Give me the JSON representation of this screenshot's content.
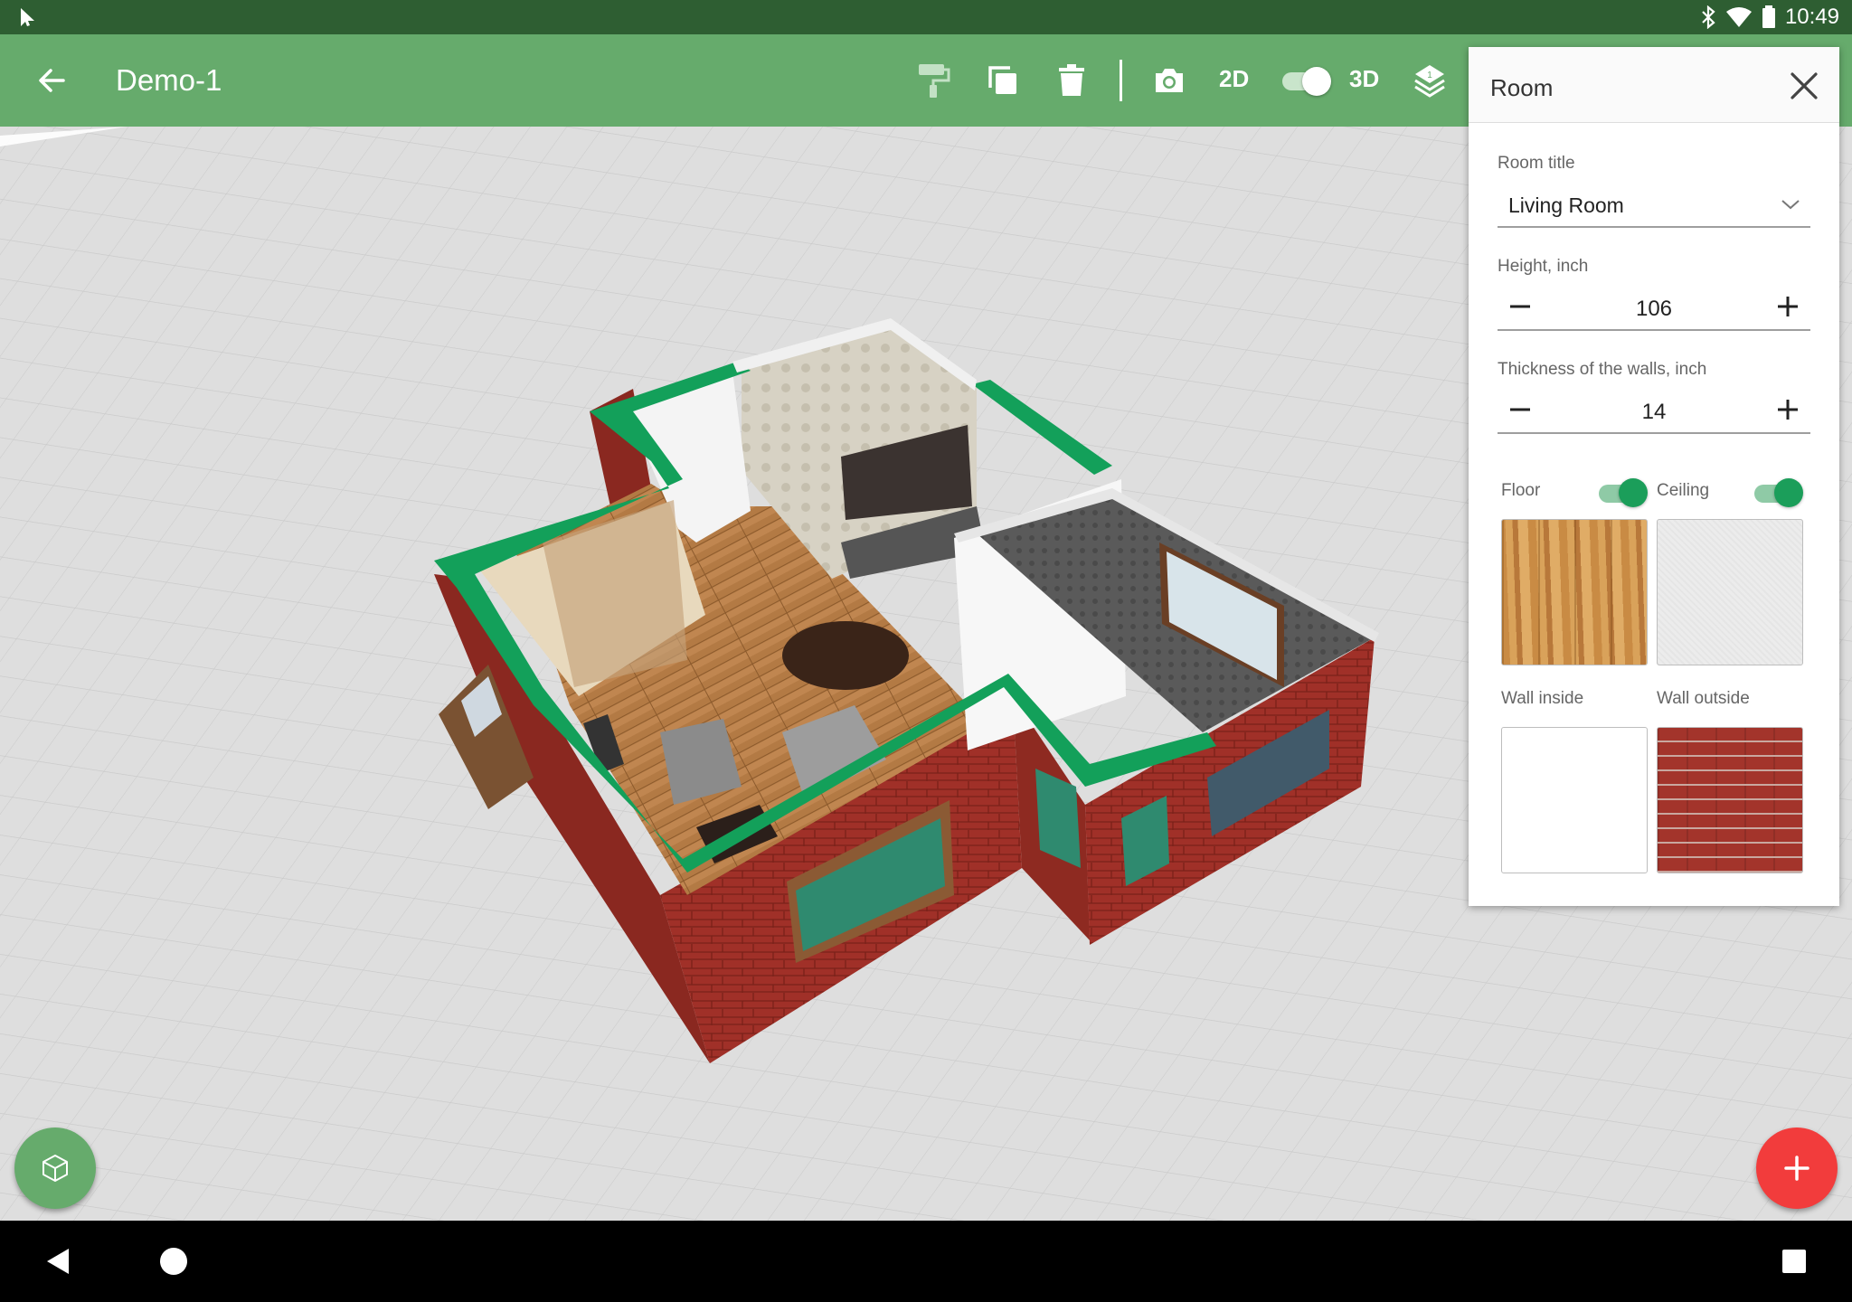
{
  "status_bar": {
    "time": "10:49"
  },
  "app_bar": {
    "title": "Demo-1",
    "view_2d_label": "2D",
    "view_3d_label": "3D"
  },
  "room_panel": {
    "title": "Room",
    "room_title_label": "Room title",
    "room_title_value": "Living Room",
    "height_label": "Height, inch",
    "height_value": "106",
    "wall_thickness_label": "Thickness of the walls, inch",
    "wall_thickness_value": "14",
    "floor_label": "Floor",
    "floor_enabled": true,
    "ceiling_label": "Ceiling",
    "ceiling_enabled": true,
    "wall_inside_label": "Wall inside",
    "wall_outside_label": "Wall outside"
  },
  "colors": {
    "status_bar": "#2e5e32",
    "app_bar": "#66ab6c",
    "accent_green": "#1b9e5a",
    "wall_top": "#13a05a",
    "brick": "#a3342b",
    "fab_add": "#f23c3c",
    "fab_3d": "#66ab6c"
  },
  "icons": {
    "back": "arrow-left-icon",
    "paint": "paint-roller-icon",
    "copy": "copy-icon",
    "delete": "trash-icon",
    "camera": "camera-icon",
    "layers": "layers-icon",
    "close": "close-icon",
    "add": "plus-icon",
    "object": "cube-icon"
  }
}
